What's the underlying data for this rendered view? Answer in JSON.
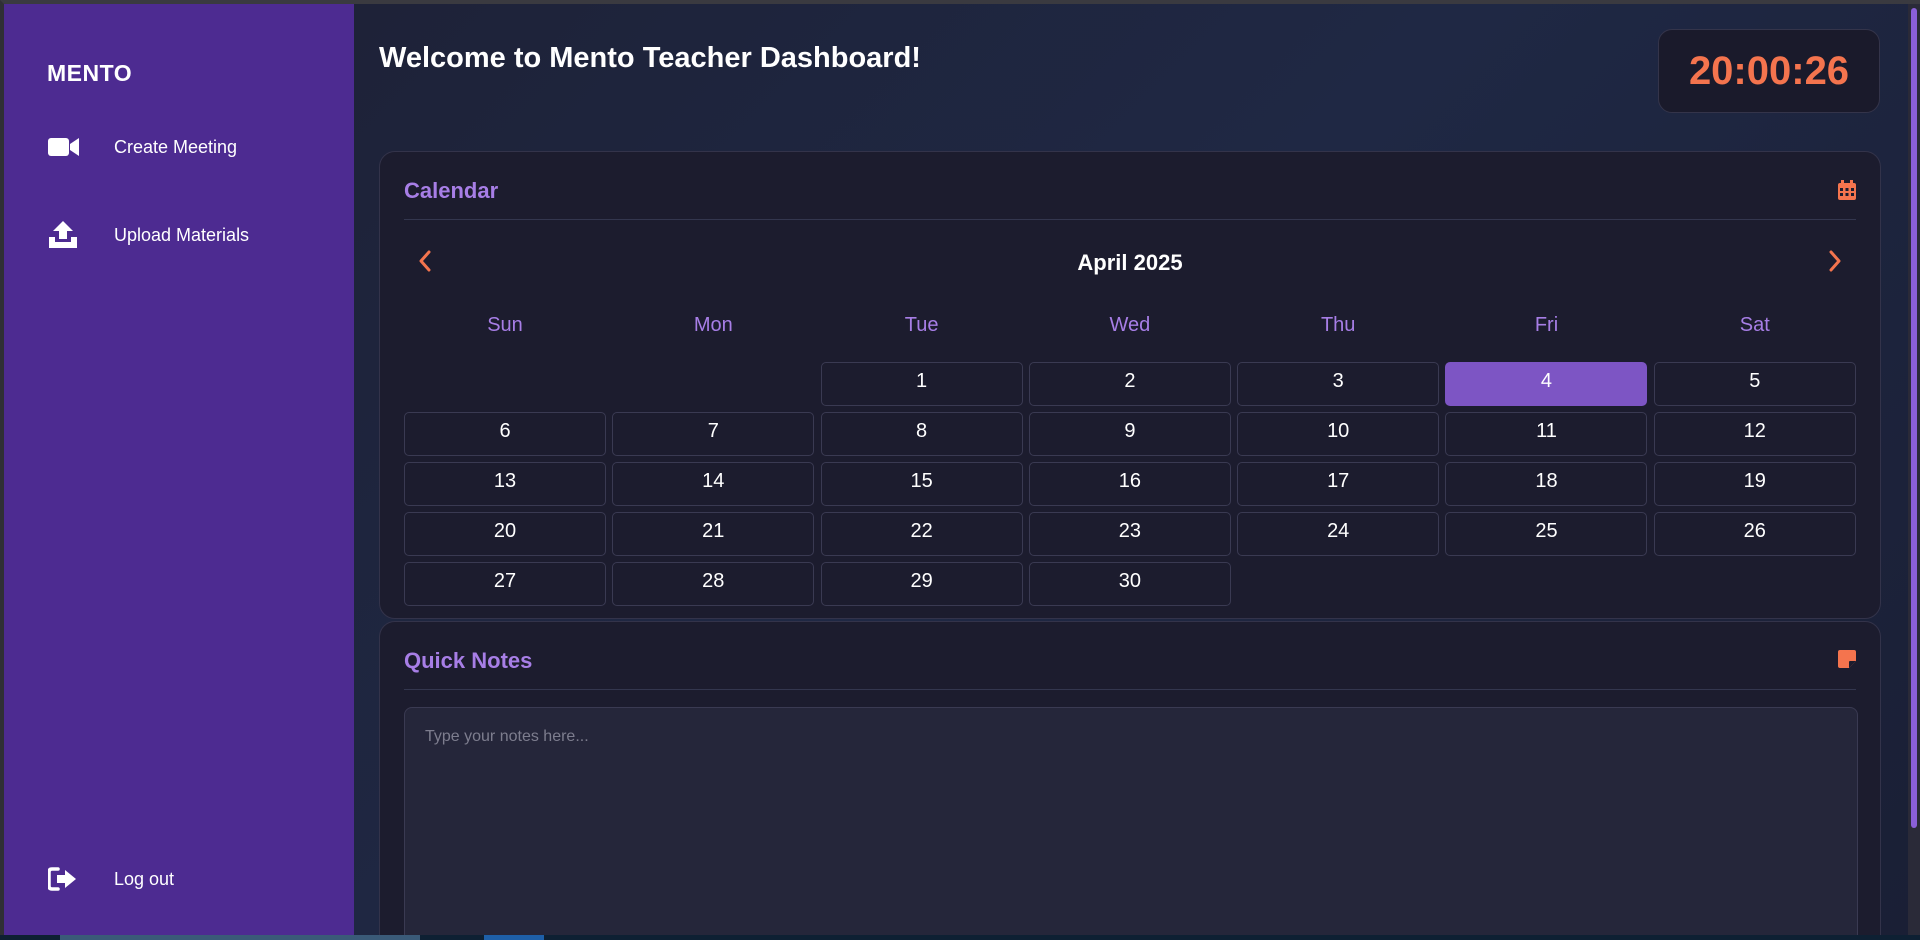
{
  "sidebar": {
    "brand": "MENTO",
    "items": [
      {
        "label": "Create Meeting",
        "icon": "video-camera-icon"
      },
      {
        "label": "Upload Materials",
        "icon": "upload-icon"
      }
    ],
    "logout_label": "Log out",
    "logout_icon": "sign-out-icon"
  },
  "header": {
    "welcome": "Welcome to Mento Teacher Dashboard!",
    "clock": "20:00:26"
  },
  "calendar": {
    "title": "Calendar",
    "icon": "calendar-icon",
    "month_label": "April 2025",
    "weekdays": [
      "Sun",
      "Mon",
      "Tue",
      "Wed",
      "Thu",
      "Fri",
      "Sat"
    ],
    "leading_blanks": 2,
    "days_in_month": 30,
    "today": 4
  },
  "notes": {
    "title": "Quick Notes",
    "icon": "sticky-note-icon",
    "placeholder": "Type your notes here...",
    "value": ""
  },
  "colors": {
    "sidebar": "#4d2b91",
    "accent_purple": "#a77ee6",
    "accent_orange": "#f4744e",
    "today": "#7d55c4"
  }
}
